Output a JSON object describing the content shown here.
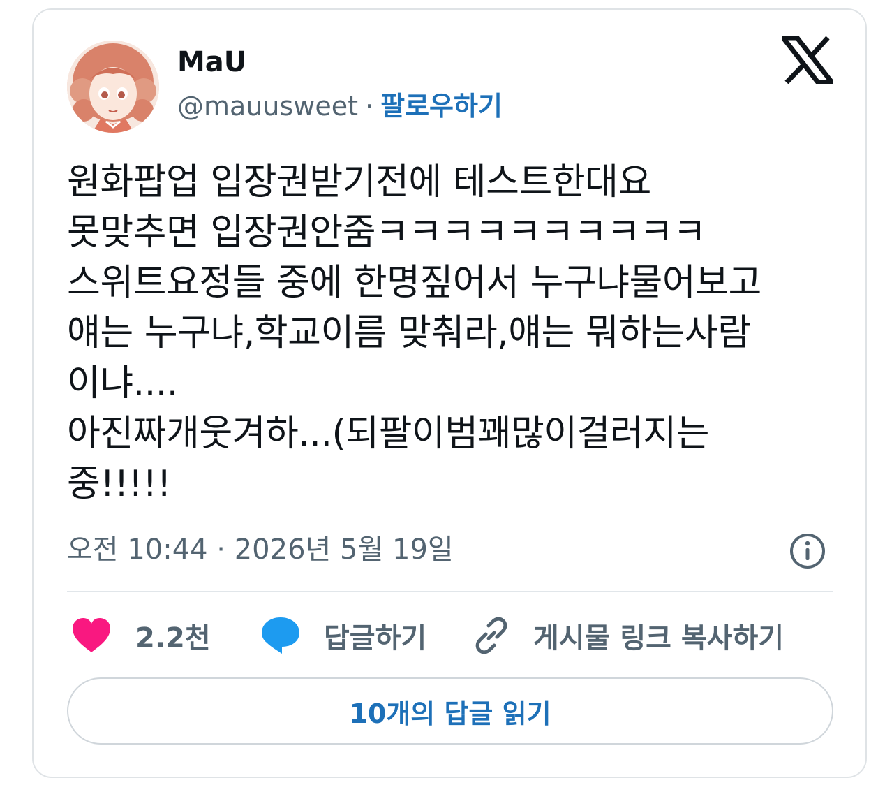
{
  "author": {
    "display_name": "MaU",
    "handle": "@mauusweet",
    "separator": "·",
    "follow_label": "팔로우하기"
  },
  "tweet": {
    "text": "원화팝업 입장권받기전에 테스트한대요\n못맞추면 입장권안줌ㅋㅋㅋㅋㅋㅋㅋㅋㅋㅋ\n스위트요정들 중에 한명짚어서 누구냐물어보고\n얘는 누구냐,학교이름 맞춰라,얘는 뭐하는사람\n이냐....\n아진짜개웃겨하...(되팔이범꽤많이걸러지는\n중!!!!!",
    "timestamp": "오전 10:44 · 2026년 5월 19일"
  },
  "actions": {
    "like_count": "2.2천",
    "reply_label": "답글하기",
    "copy_link_label": "게시물 링크 복사하기"
  },
  "read_replies_label": "10개의 답글 읽기",
  "icons": {
    "brand": "x-logo-icon",
    "info": "info-icon",
    "like": "heart-icon",
    "reply": "speech-bubble-icon",
    "link": "link-icon"
  },
  "colors": {
    "heart": "#f91880",
    "reply_bubble": "#1d9bf0",
    "link_blue": "#1d70b8",
    "secondary_text": "#536471"
  }
}
